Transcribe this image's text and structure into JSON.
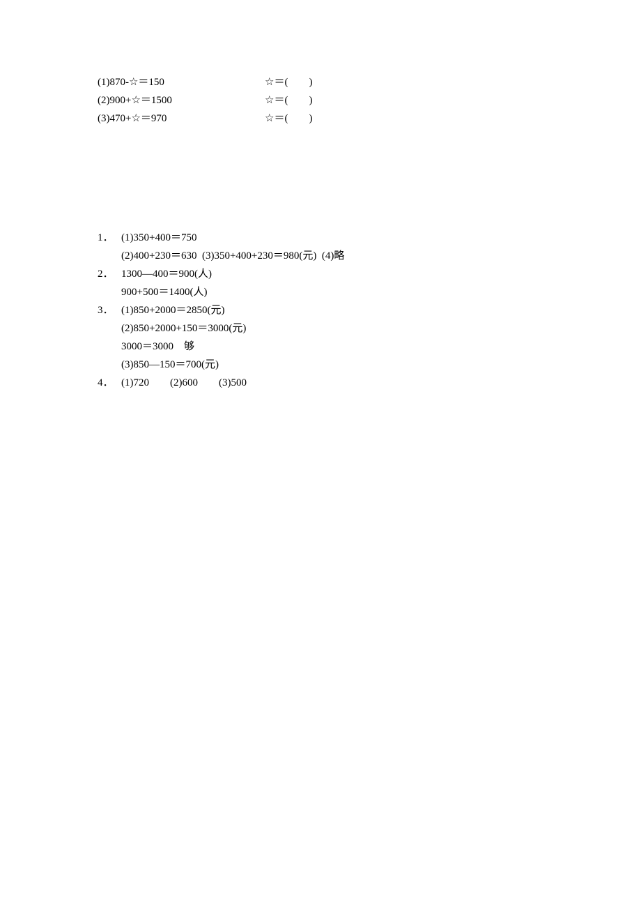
{
  "problems": [
    {
      "equation": "(1)870-☆＝150",
      "answer": "☆＝(　　)"
    },
    {
      "equation": "(2)900+☆＝1500",
      "answer": "☆＝(　　)"
    },
    {
      "equation": "(3)470+☆＝970",
      "answer": "☆＝(　　)"
    }
  ],
  "answers": {
    "a1": {
      "num": "1．",
      "line1": "(1)350+400＝750",
      "line2": "(2)400+230＝630  (3)350+400+230＝980(元)  (4)略"
    },
    "a2": {
      "num": "2．",
      "line1": "1300—400＝900(人)",
      "line2": "900+500＝1400(人)"
    },
    "a3": {
      "num": "3．",
      "line1": "(1)850+2000＝2850(元)",
      "line2": "(2)850+2000+150＝3000(元)",
      "line3": "3000＝3000　够",
      "line4": "(3)850—150＝700(元)"
    },
    "a4": {
      "num": "4．",
      "line1": "(1)720　　(2)600　　(3)500"
    }
  }
}
